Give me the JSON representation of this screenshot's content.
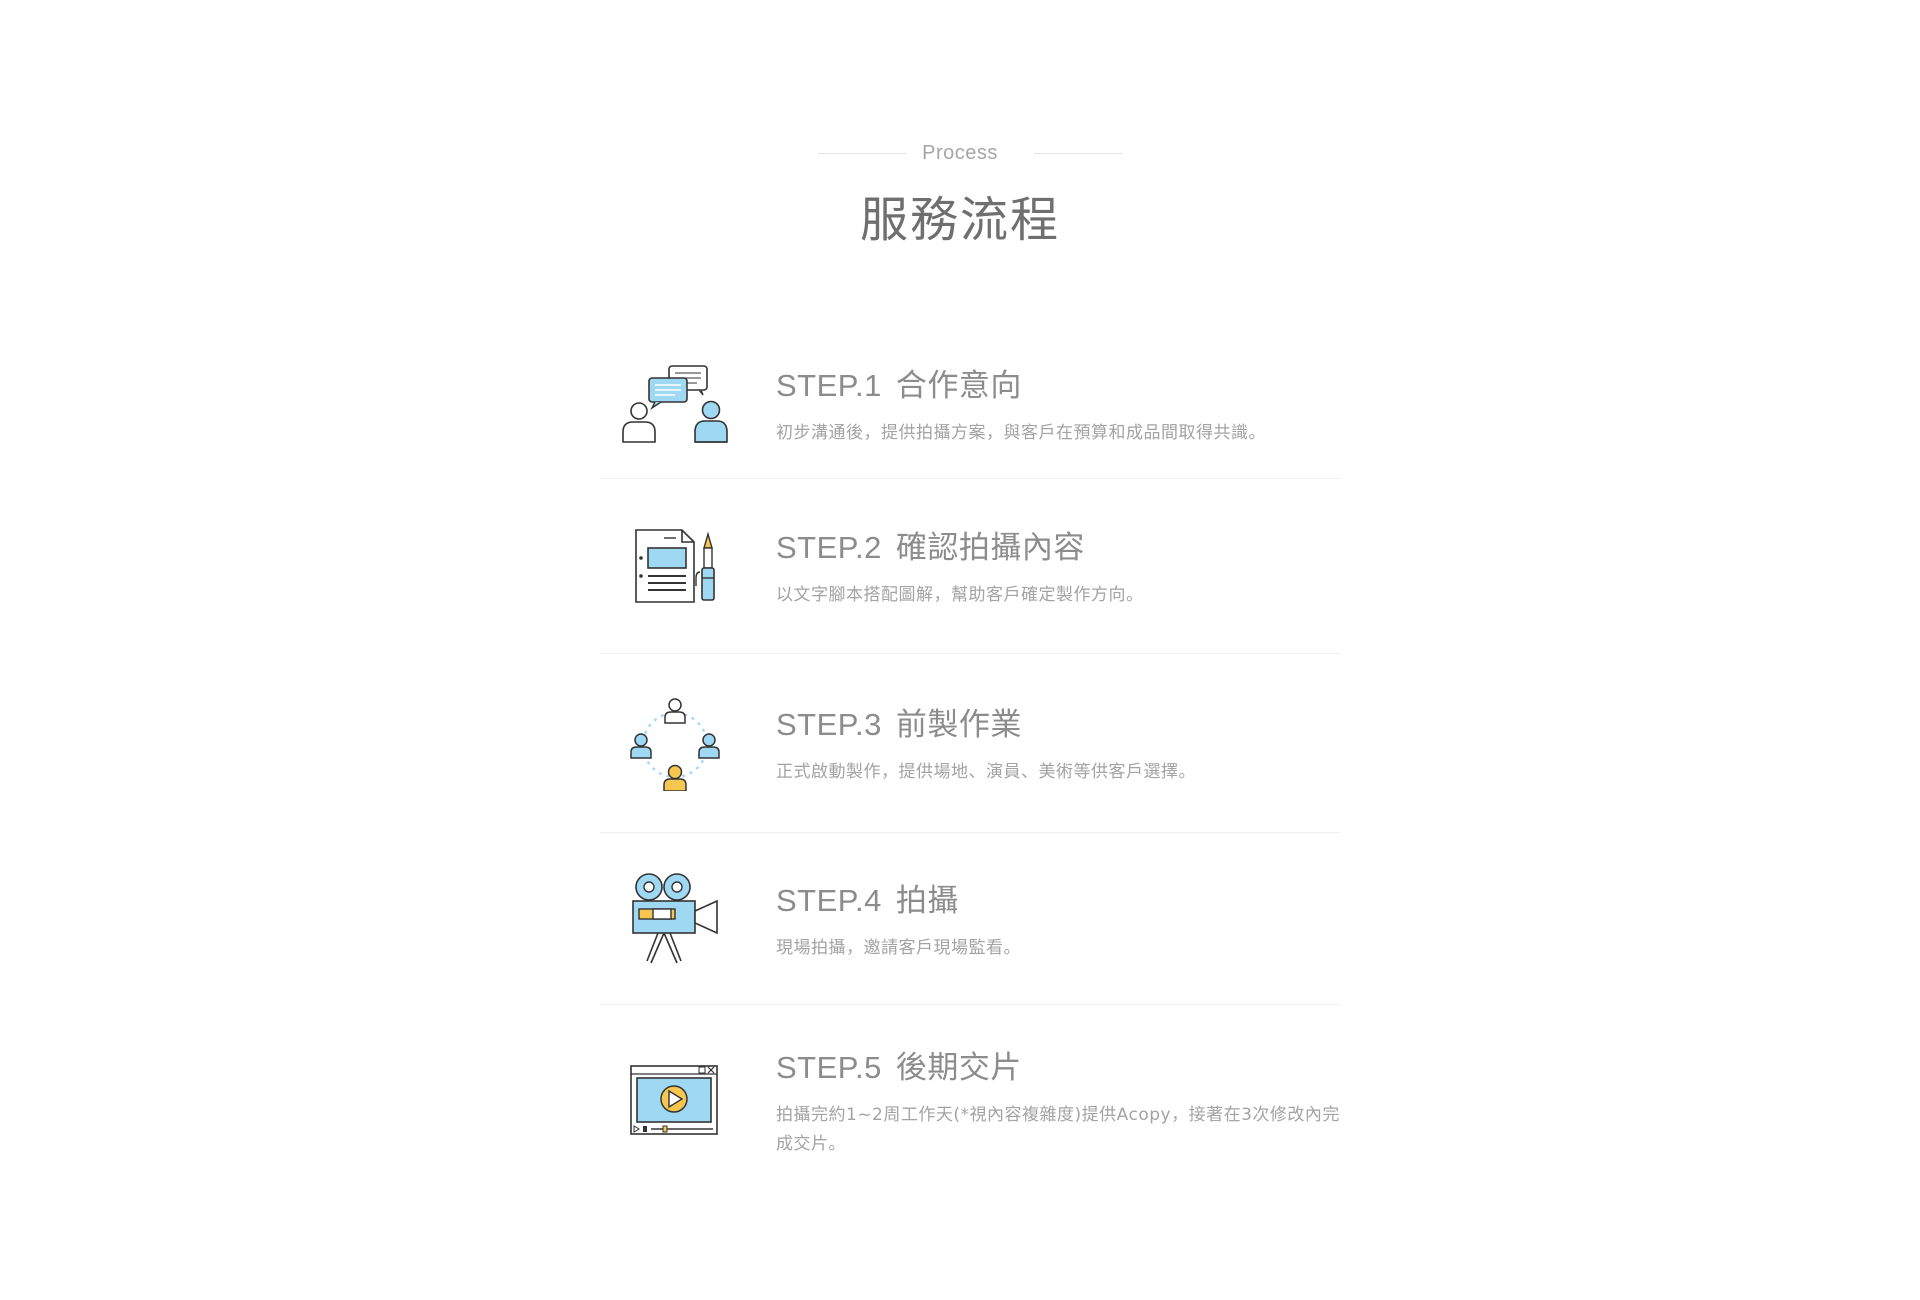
{
  "header": {
    "eyebrow": "Process",
    "title": "服務流程"
  },
  "colors": {
    "accent_blue": "#9fd8f3",
    "accent_yellow": "#f6c651",
    "outline": "#333333"
  },
  "steps": [
    {
      "number": "STEP.1",
      "title": "合作意向",
      "description": "初步溝通後，提供拍攝方案，與客戶在預算和成品間取得共識。",
      "icon": "consultation-icon"
    },
    {
      "number": "STEP.2",
      "title": "確認拍攝內容",
      "description": "以文字腳本搭配圖解，幫助客戶確定製作方向。",
      "icon": "script-document-icon"
    },
    {
      "number": "STEP.3",
      "title": "前製作業",
      "description": "正式啟動製作，提供場地、演員、美術等供客戶選擇。",
      "icon": "team-network-icon"
    },
    {
      "number": "STEP.4",
      "title": "拍攝",
      "description": "現場拍攝，邀請客戶現場監看。",
      "icon": "film-camera-icon"
    },
    {
      "number": "STEP.5",
      "title": "後期交片",
      "description": "拍攝完約1~2周工作天(*視內容複雜度)提供Acopy，接著在3次修改內完成交片。",
      "icon": "video-player-icon"
    }
  ]
}
